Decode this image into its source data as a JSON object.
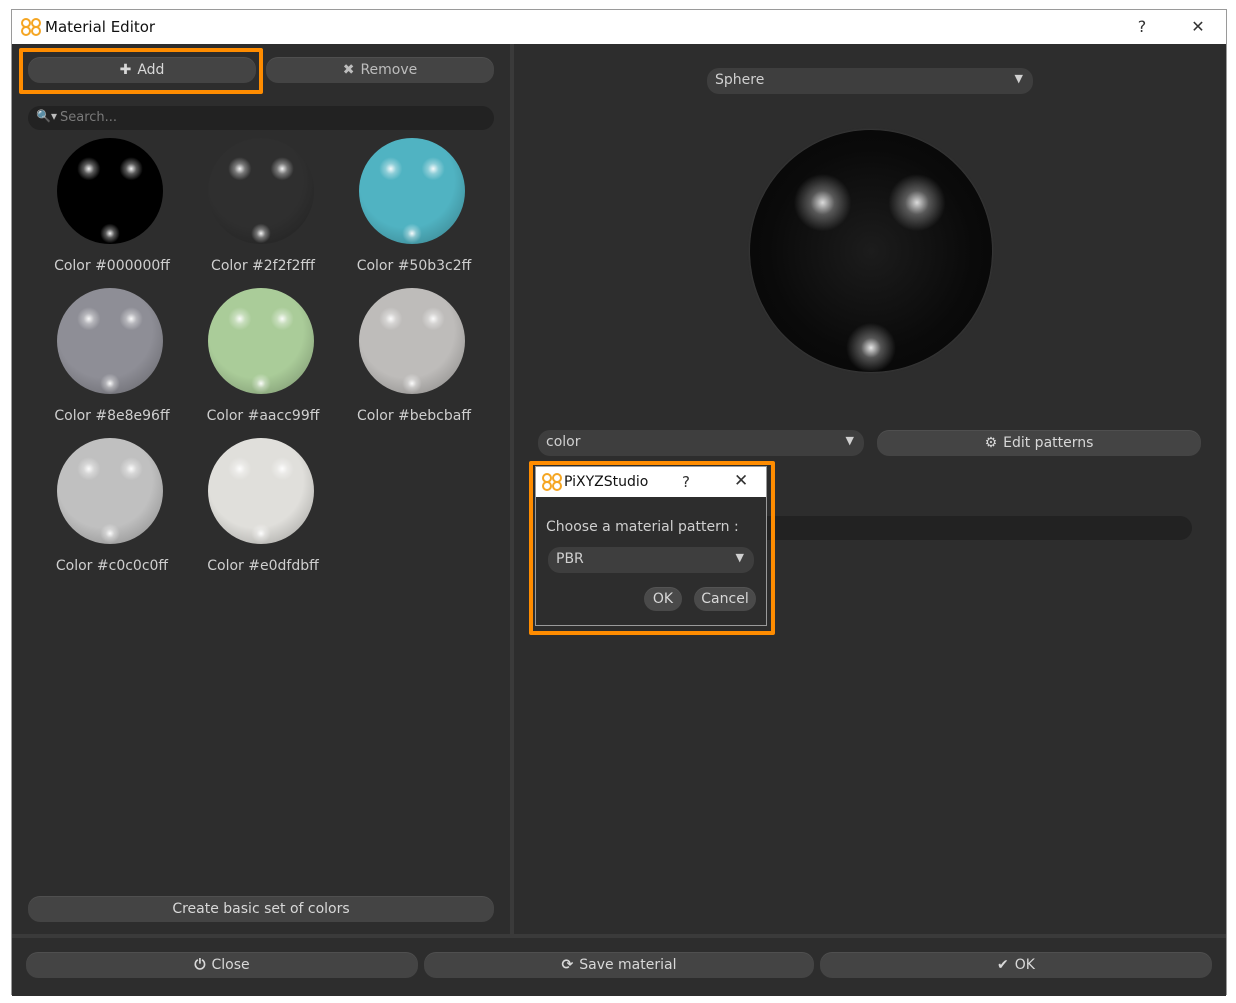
{
  "window": {
    "title": "Material Editor",
    "help": "?",
    "close": "✕"
  },
  "toolbar": {
    "add_label": "Add",
    "remove_label": "Remove"
  },
  "search": {
    "placeholder": "Search..."
  },
  "materials": [
    {
      "label": "Color #000000ff",
      "color": "#000000"
    },
    {
      "label": "Color #2f2f2fff",
      "color": "#2f2f2f"
    },
    {
      "label": "Color #50b3c2ff",
      "color": "#50b3c2"
    },
    {
      "label": "Color #8e8e96ff",
      "color": "#8e8e96"
    },
    {
      "label": "Color #aacc99ff",
      "color": "#aacc99"
    },
    {
      "label": "Color #bebcbaff",
      "color": "#bebcba"
    },
    {
      "label": "Color #c0c0c0ff",
      "color": "#c0c0c0"
    },
    {
      "label": "Color #e0dfdbff",
      "color": "#e0dfdb"
    }
  ],
  "left_footer": {
    "create_label": "Create basic set of colors"
  },
  "preview": {
    "shape": "Sphere"
  },
  "pattern": {
    "selected": "color",
    "edit_label": "Edit patterns"
  },
  "dialog": {
    "title": "PiXYZStudio",
    "help": "?",
    "close": "✕",
    "prompt": "Choose a material pattern :",
    "selected": "PBR",
    "ok_label": "OK",
    "cancel_label": "Cancel"
  },
  "footer": {
    "close_label": "Close",
    "save_label": "Save material",
    "ok_label": "OK"
  },
  "colors": {
    "accent": "#ff8c00",
    "panel": "#2d2d2d",
    "button": "#444444"
  }
}
